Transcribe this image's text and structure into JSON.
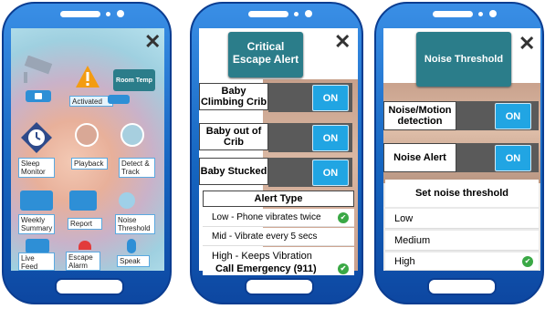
{
  "close_label": "✕",
  "screen1": {
    "room_temp": "Room Temp",
    "activated": "Activated",
    "sleep_monitor": "Sleep Monitor",
    "playback": "Playback",
    "detect_track": "Detect & Track",
    "weekly_summary": "Weekly Summary",
    "report": "Report",
    "noise_threshold": "Noise Threshold",
    "live_feed": "Live Feed",
    "escape_alarm": "Escape Alarm",
    "speak": "Speak"
  },
  "screen2": {
    "title": "Critical Escape Alert",
    "toggles": [
      {
        "label": "Baby Climbing Crib",
        "state": "ON"
      },
      {
        "label": "Baby out of Crib",
        "state": "ON"
      },
      {
        "label": "Baby Stucked",
        "state": "ON"
      }
    ],
    "alert_type_header": "Alert Type",
    "options": [
      {
        "label": "Low - Phone vibrates twice",
        "selected": true
      },
      {
        "label": "Mid  - Vibrate every 5 secs",
        "selected": false
      },
      {
        "label": "High - Keeps Vibration",
        "selected": false
      },
      {
        "label": "Call Emergency (911)",
        "selected": true
      }
    ]
  },
  "screen3": {
    "title": "Noise Threshold",
    "toggles": [
      {
        "label": "Noise/Motion detection",
        "state": "ON"
      },
      {
        "label": "Noise Alert",
        "state": "ON"
      }
    ],
    "set_header": "Set noise threshold",
    "options": [
      {
        "label": "Low",
        "selected": false
      },
      {
        "label": "Medium",
        "selected": false
      },
      {
        "label": "High",
        "selected": true
      }
    ]
  },
  "colors": {
    "phone": "#1565c0",
    "accent": "#21a5e3",
    "title_teal": "#2b7d8a",
    "check": "#3aa845"
  }
}
